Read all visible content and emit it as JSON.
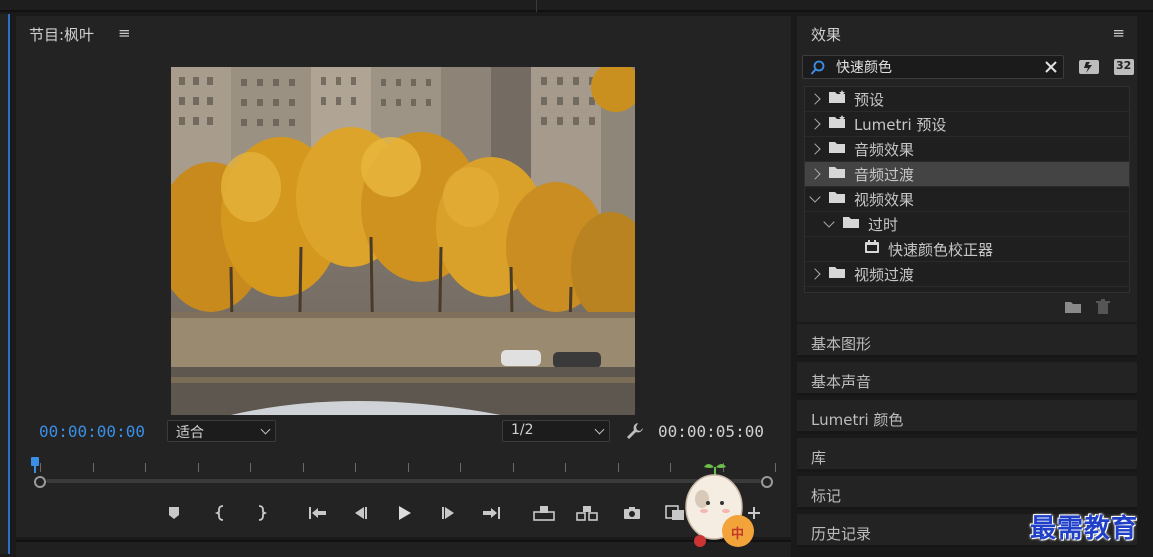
{
  "program": {
    "title": "节目:枫叶",
    "menu_icon": "hamburger-menu-icon",
    "timecode_current": "00:00:00:00",
    "timecode_duration": "00:00:05:00",
    "fit_value": "适合",
    "resolution_value": "1/2"
  },
  "effects": {
    "title": "效果",
    "search_value": "快速颜色",
    "tree": [
      {
        "label": "预设",
        "level": 0,
        "expanded": false,
        "icon": "preset-folder-icon",
        "selected": false
      },
      {
        "label": "Lumetri 预设",
        "level": 0,
        "expanded": false,
        "icon": "preset-folder-icon",
        "selected": false
      },
      {
        "label": "音频效果",
        "level": 0,
        "expanded": false,
        "icon": "folder-icon",
        "selected": false
      },
      {
        "label": "音频过渡",
        "level": 0,
        "expanded": false,
        "icon": "folder-icon",
        "selected": true
      },
      {
        "label": "视频效果",
        "level": 0,
        "expanded": true,
        "icon": "folder-icon",
        "selected": false
      },
      {
        "label": "过时",
        "level": 1,
        "expanded": true,
        "icon": "folder-icon",
        "selected": false
      },
      {
        "label": "快速颜色校正器",
        "level": 2,
        "expanded": null,
        "icon": "effect-icon",
        "selected": false
      },
      {
        "label": "视频过渡",
        "level": 0,
        "expanded": false,
        "icon": "folder-icon",
        "selected": false
      }
    ],
    "btn_32": "32"
  },
  "panels": {
    "essential_graphics": "基本图形",
    "essential_sound": "基本声音",
    "lumetri_color": "Lumetri 颜色",
    "libraries": "库",
    "markers": "标记",
    "history": "历史记录"
  },
  "mascot_label": "中",
  "watermark": "最需教育",
  "colors": {
    "accent_blue": "#3a8ee6",
    "selection": "#444444",
    "panel_bg": "#232323"
  }
}
